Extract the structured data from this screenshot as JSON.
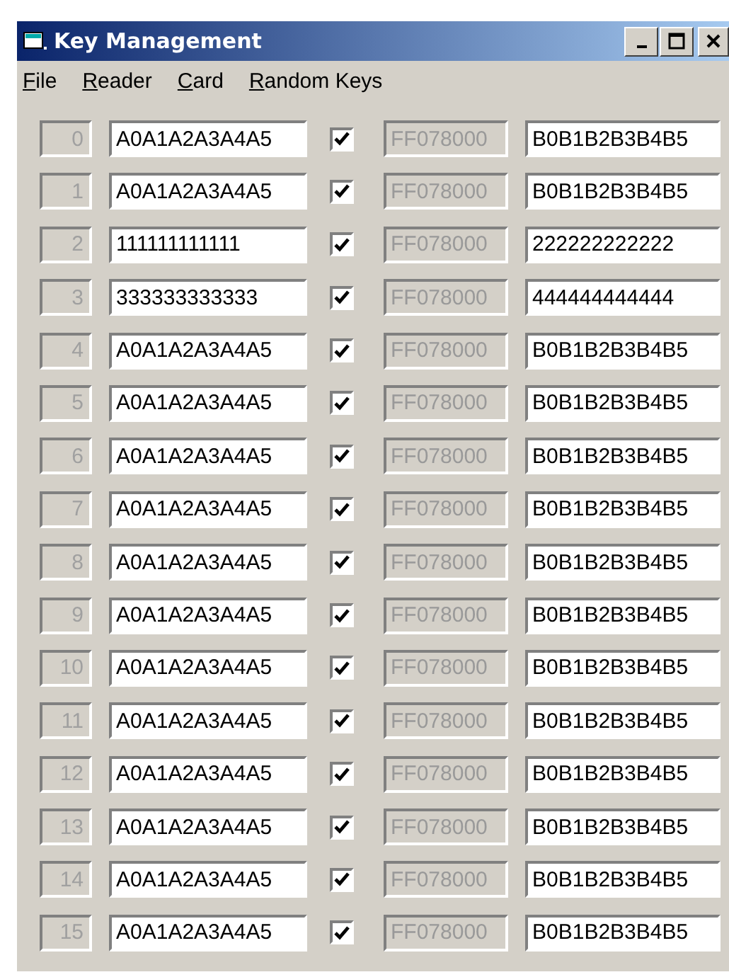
{
  "window": {
    "title": "Key Management"
  },
  "menu": [
    {
      "label": "File"
    },
    {
      "label": "Reader"
    },
    {
      "label": "Card"
    },
    {
      "label": "Random Keys"
    }
  ],
  "rows": [
    {
      "sector": "0",
      "key_a": "A0A1A2A3A4A5",
      "checked": true,
      "access_bits": "FF078000",
      "key_b": "B0B1B2B3B4B5"
    },
    {
      "sector": "1",
      "key_a": "A0A1A2A3A4A5",
      "checked": true,
      "access_bits": "FF078000",
      "key_b": "B0B1B2B3B4B5"
    },
    {
      "sector": "2",
      "key_a": "111111111111",
      "checked": true,
      "access_bits": "FF078000",
      "key_b": "222222222222"
    },
    {
      "sector": "3",
      "key_a": "333333333333",
      "checked": true,
      "access_bits": "FF078000",
      "key_b": "444444444444"
    },
    {
      "sector": "4",
      "key_a": "A0A1A2A3A4A5",
      "checked": true,
      "access_bits": "FF078000",
      "key_b": "B0B1B2B3B4B5"
    },
    {
      "sector": "5",
      "key_a": "A0A1A2A3A4A5",
      "checked": true,
      "access_bits": "FF078000",
      "key_b": "B0B1B2B3B4B5"
    },
    {
      "sector": "6",
      "key_a": "A0A1A2A3A4A5",
      "checked": true,
      "access_bits": "FF078000",
      "key_b": "B0B1B2B3B4B5"
    },
    {
      "sector": "7",
      "key_a": "A0A1A2A3A4A5",
      "checked": true,
      "access_bits": "FF078000",
      "key_b": "B0B1B2B3B4B5"
    },
    {
      "sector": "8",
      "key_a": "A0A1A2A3A4A5",
      "checked": true,
      "access_bits": "FF078000",
      "key_b": "B0B1B2B3B4B5"
    },
    {
      "sector": "9",
      "key_a": "A0A1A2A3A4A5",
      "checked": true,
      "access_bits": "FF078000",
      "key_b": "B0B1B2B3B4B5"
    },
    {
      "sector": "10",
      "key_a": "A0A1A2A3A4A5",
      "checked": true,
      "access_bits": "FF078000",
      "key_b": "B0B1B2B3B4B5"
    },
    {
      "sector": "11",
      "key_a": "A0A1A2A3A4A5",
      "checked": true,
      "access_bits": "FF078000",
      "key_b": "B0B1B2B3B4B5"
    },
    {
      "sector": "12",
      "key_a": "A0A1A2A3A4A5",
      "checked": true,
      "access_bits": "FF078000",
      "key_b": "B0B1B2B3B4B5"
    },
    {
      "sector": "13",
      "key_a": "A0A1A2A3A4A5",
      "checked": true,
      "access_bits": "FF078000",
      "key_b": "B0B1B2B3B4B5"
    },
    {
      "sector": "14",
      "key_a": "A0A1A2A3A4A5",
      "checked": true,
      "access_bits": "FF078000",
      "key_b": "B0B1B2B3B4B5"
    },
    {
      "sector": "15",
      "key_a": "A0A1A2A3A4A5",
      "checked": true,
      "access_bits": "FF078000",
      "key_b": "B0B1B2B3B4B5"
    }
  ]
}
